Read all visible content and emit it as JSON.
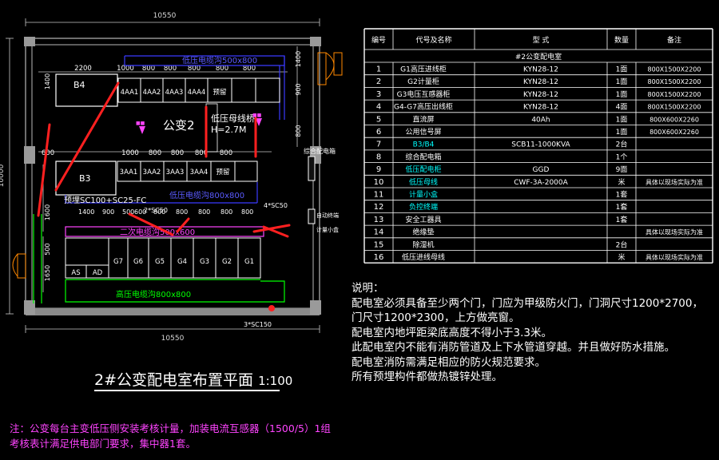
{
  "plan": {
    "title": "2#公变配电室布置平面",
    "scale": "1:100",
    "dims": {
      "width_top": "10550",
      "width_bottom": "10550",
      "height_left": "10000",
      "d2200": "2200",
      "d1000": "1000",
      "d800": "800",
      "d1400": "1400",
      "d900": "900",
      "d600": "600",
      "d1600": "1600",
      "d500": "500",
      "d1650": "1650"
    },
    "transformer_top": "B4",
    "transformer_mid": "B3",
    "transformer_label": "公变2",
    "busway": "低压母线桥",
    "busway_h": "H=2.7M",
    "lv_trench_top": "低压电缆沟500x800",
    "lv_trench_mid": "低压电缆沟800x800",
    "sec_trench": "二次电缆沟500x600",
    "hv_trench": "高压电缆沟800x800",
    "pipe1": "预埋SC100+SC25-FC",
    "pipe2": "2*SC50",
    "pipe3": "4*SC50",
    "pipe4": "3*SC150",
    "panels_top": [
      "4AA1",
      "4AA2",
      "4AA3",
      "4AA4",
      "预留"
    ],
    "panels_mid": [
      "3AA1",
      "3AA2",
      "3AA3",
      "3AA4",
      "预留"
    ],
    "hv_panels": [
      "AS",
      "AD",
      "G7",
      "G6",
      "G5",
      "G4",
      "G3",
      "G2",
      "G1"
    ],
    "side_label1": "综合配电箱",
    "side_label2": "自动终端",
    "side_label3": "计量小盒"
  },
  "table": {
    "headers": [
      "编号",
      "代号及名称",
      "型  式",
      "数量",
      "备注"
    ],
    "section": "#2公变配电室",
    "rows": [
      {
        "no": "1",
        "name": "G1高压进线柜",
        "type": "KYN28-12",
        "qty": "1面",
        "note": "800X1500X2200"
      },
      {
        "no": "2",
        "name": "G2计量柜",
        "type": "KYN28-12",
        "qty": "1面",
        "note": "800X1500X2200"
      },
      {
        "no": "3",
        "name": "G3电压互感器柜",
        "type": "KYN28-12",
        "qty": "1面",
        "note": "800X1500X2200"
      },
      {
        "no": "4",
        "name": "G4-G7高压出线柜",
        "type": "KYN28-12",
        "qty": "4面",
        "note": "800X1500X2200"
      },
      {
        "no": "5",
        "name": "直流屏",
        "type": "40Ah",
        "qty": "1面",
        "note": "800X600X2260"
      },
      {
        "no": "6",
        "name": "公用信号屏",
        "type": "",
        "qty": "1面",
        "note": "800X600X2260"
      },
      {
        "no": "7",
        "name": "B3/B4",
        "type": "SCB11-1000KVA",
        "qty": "2台",
        "note": ""
      },
      {
        "no": "8",
        "name": "综合配电箱",
        "type": "",
        "qty": "1个",
        "note": ""
      },
      {
        "no": "9",
        "name": "低压配电柜",
        "type": "GGD",
        "qty": "9面",
        "note": ""
      },
      {
        "no": "10",
        "name": "低压母线",
        "type": "CWF-3A-2000A",
        "qty": "米",
        "note": "具体以现场实际为准"
      },
      {
        "no": "11",
        "name": "计量小盒",
        "type": "",
        "qty": "1套",
        "note": ""
      },
      {
        "no": "12",
        "name": "负控终端",
        "type": "",
        "qty": "1套",
        "note": ""
      },
      {
        "no": "13",
        "name": "安全工器具",
        "type": "",
        "qty": "1套",
        "note": ""
      },
      {
        "no": "14",
        "name": "绝缘垫",
        "type": "",
        "qty": "",
        "note": "具体以现场实际为准"
      },
      {
        "no": "15",
        "name": "除湿机",
        "type": "",
        "qty": "2台",
        "note": ""
      },
      {
        "no": "16",
        "name": "低压进线母线",
        "type": "",
        "qty": "米",
        "note": "具体以现场实际为准"
      }
    ]
  },
  "notes": {
    "heading": "说明：",
    "lines": [
      "配电室必须具备至少两个门，门应为甲级防火门，门洞尺寸1200*2700，",
      "门尺寸1200*2300，上方做亮窗。",
      "配电室内地坪距梁底高度不得小于3.3米。",
      "此配电室内不能有消防管道及上下水管道穿越。并且做好防水措施。",
      "配电室消防需满足相应的防火规范要求。",
      "所有预埋构件都做热镀锌处理。"
    ]
  },
  "footnote": [
    "注：公变每台主变低压侧安装考核计量，加装电流互感器（1500/5）1组",
    "考核表计满足供电部门要求，集中器1套。"
  ],
  "colors": {
    "wall": "#b8b8b8",
    "blue": "#3b3bff",
    "green": "#00ff00",
    "magenta": "#ff44ff",
    "red": "#ff2020",
    "cyan": "#00ffff",
    "yellow": "#ffff00"
  }
}
